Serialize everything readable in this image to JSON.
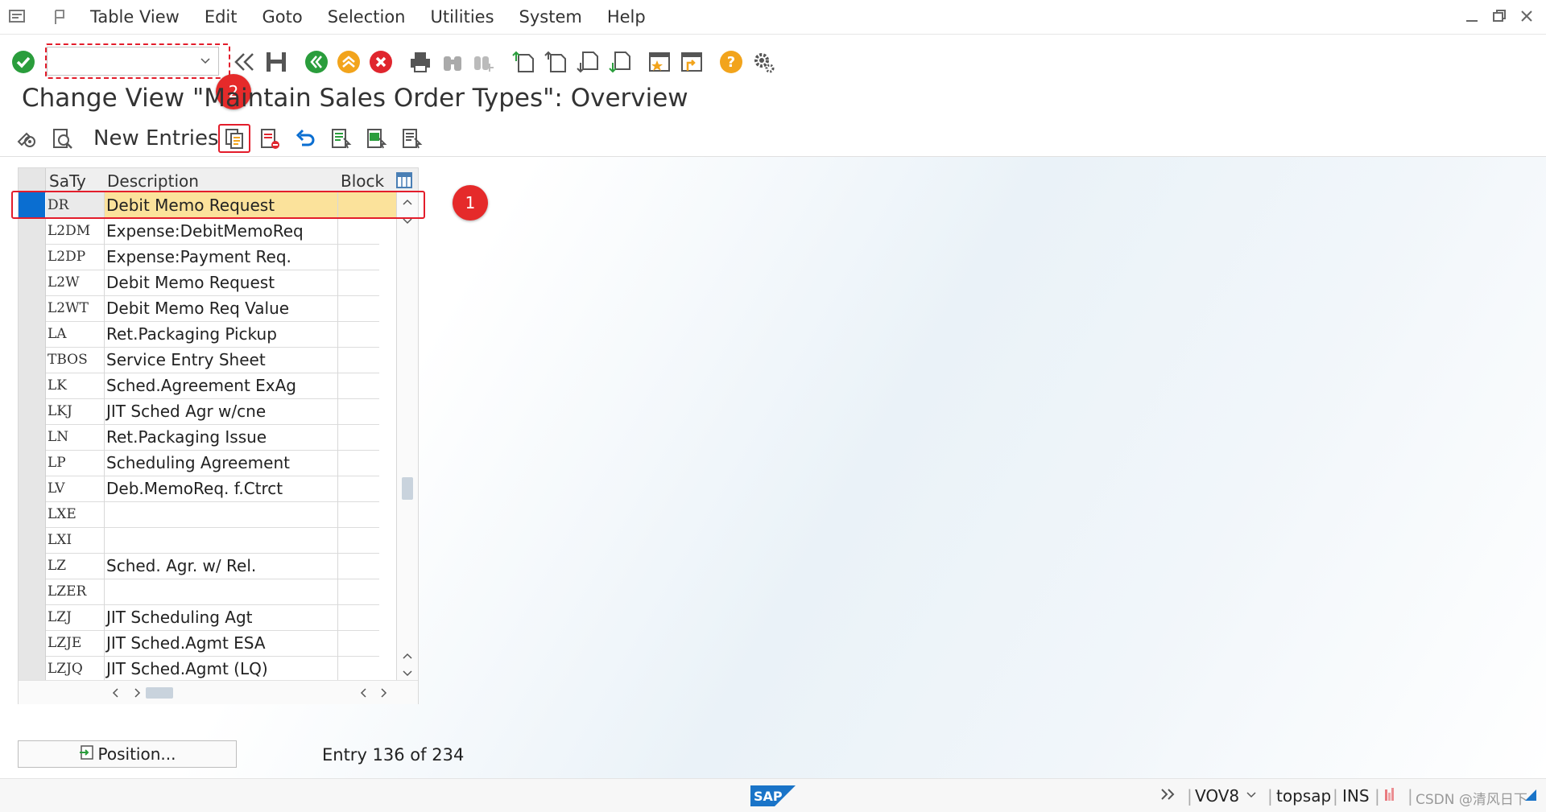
{
  "menubar": {
    "items": [
      "Table View",
      "Edit",
      "Goto",
      "Selection",
      "Utilities",
      "System",
      "Help"
    ]
  },
  "toolbar": {
    "command_field_value": ""
  },
  "page": {
    "title": "Change View \"Maintain Sales Order Types\": Overview"
  },
  "app_toolbar": {
    "new_entries_label": "New Entries"
  },
  "table": {
    "columns": [
      "SaTy",
      "Description",
      "Block"
    ],
    "rows": [
      {
        "saty": "DR",
        "description": "Debit Memo Request",
        "block": "",
        "selected": true
      },
      {
        "saty": "L2DM",
        "description": "Expense:DebitMemoReq",
        "block": ""
      },
      {
        "saty": "L2DP",
        "description": "Expense:Payment Req.",
        "block": ""
      },
      {
        "saty": "L2W",
        "description": "Debit Memo Request",
        "block": ""
      },
      {
        "saty": "L2WT",
        "description": "Debit Memo Req Value",
        "block": ""
      },
      {
        "saty": "LA",
        "description": "Ret.Packaging Pickup",
        "block": ""
      },
      {
        "saty": "TBOS",
        "description": "Service Entry Sheet",
        "block": ""
      },
      {
        "saty": "LK",
        "description": "Sched.Agreement ExAg",
        "block": ""
      },
      {
        "saty": "LKJ",
        "description": "JIT Sched Agr w/cne",
        "block": ""
      },
      {
        "saty": "LN",
        "description": "Ret.Packaging Issue",
        "block": ""
      },
      {
        "saty": "LP",
        "description": "Scheduling Agreement",
        "block": ""
      },
      {
        "saty": "LV",
        "description": "Deb.MemoReq. f.Ctrct",
        "block": ""
      },
      {
        "saty": "LXE",
        "description": "",
        "block": ""
      },
      {
        "saty": "LXI",
        "description": "",
        "block": ""
      },
      {
        "saty": "LZ",
        "description": "Sched. Agr. w/ Rel.",
        "block": ""
      },
      {
        "saty": "LZER",
        "description": "",
        "block": ""
      },
      {
        "saty": "LZJ",
        "description": "JIT Scheduling Agt",
        "block": ""
      },
      {
        "saty": "LZJE",
        "description": "JIT Sched.Agmt ESA",
        "block": ""
      },
      {
        "saty": "LZJQ",
        "description": "JIT Sched.Agmt (LQ)",
        "block": ""
      }
    ]
  },
  "footer": {
    "position_button_label": "Position...",
    "entry_info": "Entry 136 of 234"
  },
  "annotations": {
    "badge_1": "1",
    "badge_2": "2"
  },
  "statusbar": {
    "logo": "SAP",
    "transaction": "VOV8",
    "system": "topsap",
    "mode": "INS",
    "watermark": "CSDN @清风日下"
  },
  "colors": {
    "accent_blue": "#0a6ed1",
    "selected_row": "#fbe29b",
    "annotation_red": "#e31d2b",
    "ok_green": "#2a9d3c",
    "cancel_red": "#e0262e",
    "help_orange": "#f2a41c"
  }
}
